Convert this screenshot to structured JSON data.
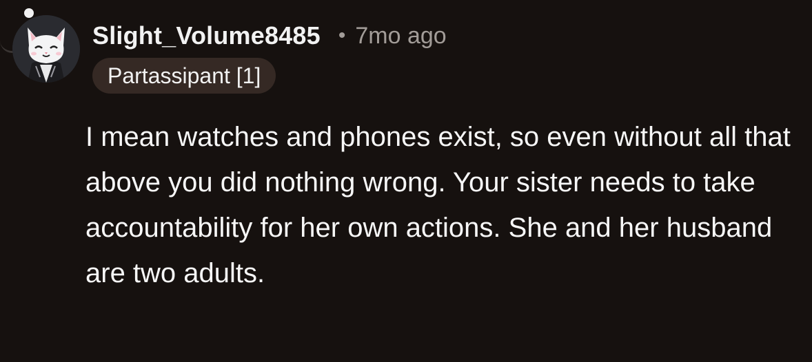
{
  "comment": {
    "username": "Slight_Volume8485",
    "separator": "•",
    "timestamp": "7mo ago",
    "flair": "Partassipant [1]",
    "text": "I mean watches and phones exist, so even without all that above you did nothing wrong. Your sister needs to take accountability for her own actions. She and her husband are two adults.",
    "avatar_icon": "cat-avatar-icon"
  },
  "colors": {
    "background": "#16110f",
    "meta_text": "#a29c98",
    "flair_background": "#352924"
  }
}
